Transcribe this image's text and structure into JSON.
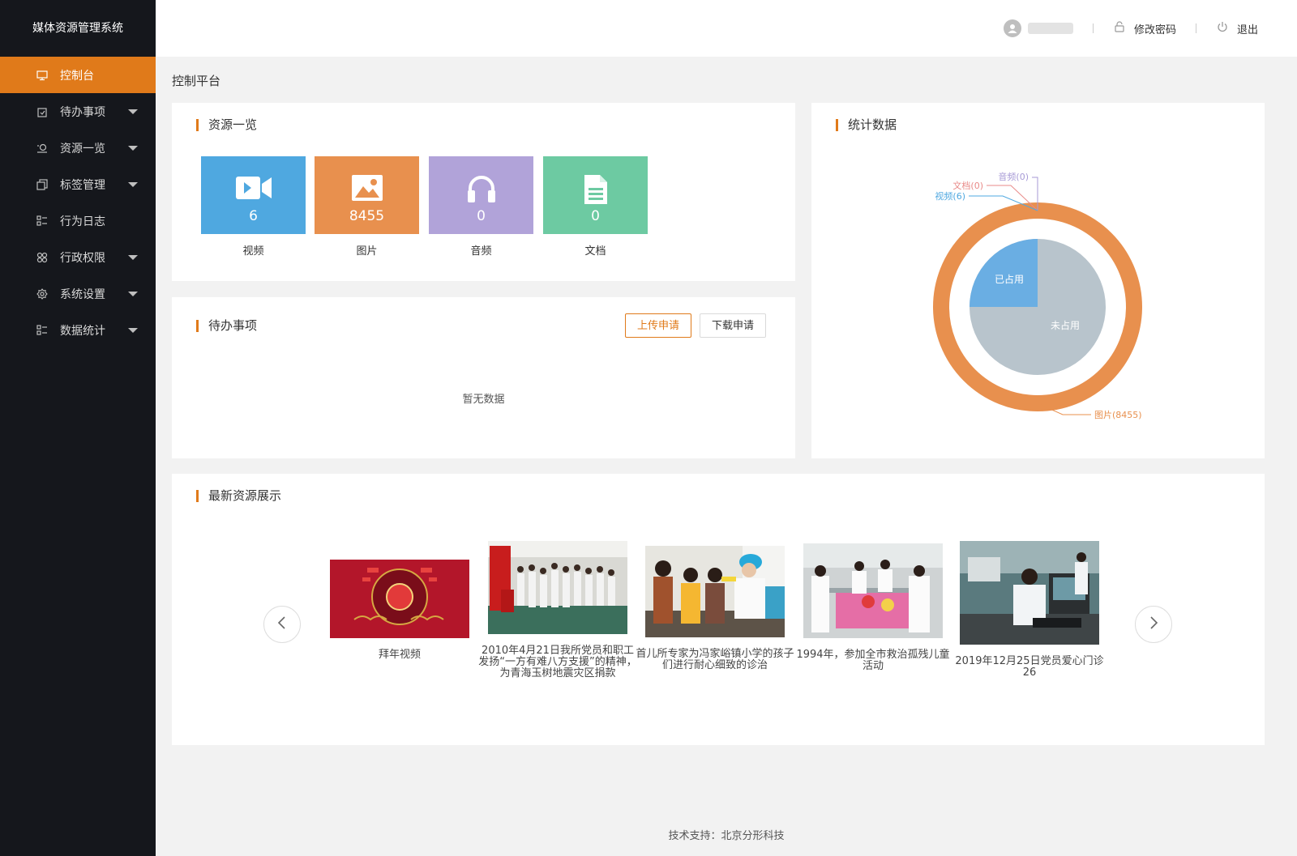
{
  "app": {
    "title": "媒体资源管理系统"
  },
  "sidebar": {
    "items": [
      {
        "label": "控制台",
        "icon": "monitor-icon",
        "active": true,
        "caret": false
      },
      {
        "label": "待办事项",
        "icon": "todo-icon",
        "caret": true
      },
      {
        "label": "资源一览",
        "icon": "resource-search-icon",
        "caret": true
      },
      {
        "label": "标签管理",
        "icon": "tag-copy-icon",
        "caret": true
      },
      {
        "label": "行为日志",
        "icon": "log-list-icon",
        "caret": false
      },
      {
        "label": "行政权限",
        "icon": "permission-grid-icon",
        "caret": true
      },
      {
        "label": "系统设置",
        "icon": "gear-icon",
        "caret": true
      },
      {
        "label": "数据统计",
        "icon": "stats-list-icon",
        "caret": true
      }
    ]
  },
  "header": {
    "change_password": "修改密码",
    "logout": "退出"
  },
  "page": {
    "title": "控制平台"
  },
  "resources": {
    "title": "资源一览",
    "tiles": [
      {
        "label": "视频",
        "count": "6",
        "color": "#4fa8e0",
        "icon": "video-camera-icon"
      },
      {
        "label": "图片",
        "count": "8455",
        "color": "#e8904e",
        "icon": "image-icon"
      },
      {
        "label": "音频",
        "count": "0",
        "color": "#b1a3d9",
        "icon": "headphones-icon"
      },
      {
        "label": "文档",
        "count": "0",
        "color": "#6dcaa2",
        "icon": "document-icon"
      }
    ]
  },
  "todo": {
    "title": "待办事项",
    "upload_btn": "上传申请",
    "download_btn": "下载申请",
    "empty_text": "暂无数据"
  },
  "stats": {
    "title": "统计数据",
    "outer_labels": {
      "audio": "音频(0)",
      "document": "文档(0)",
      "video": "视频(6)",
      "image": "图片(8455)"
    },
    "inner_labels": {
      "used": "已占用",
      "unused": "未占用"
    },
    "colors": {
      "image": "#e8904e",
      "video": "#4fa8e0",
      "document": "#e98a88",
      "audio": "#a79ad6",
      "used": "#6aaee3",
      "unused": "#b8c4cc"
    }
  },
  "chart_data": {
    "type": "pie",
    "outer_ring": [
      {
        "name": "图片",
        "value": 8455
      },
      {
        "name": "视频",
        "value": 6
      },
      {
        "name": "文档",
        "value": 0
      },
      {
        "name": "音频",
        "value": 0
      }
    ],
    "inner_pie": [
      {
        "name": "已占用",
        "value": 25
      },
      {
        "name": "未占用",
        "value": 75
      }
    ]
  },
  "latest": {
    "title": "最新资源展示",
    "items": [
      {
        "caption": "拜年视频"
      },
      {
        "caption": "2010年4月21日我所党员和职工发扬“一方有难八方支援”的精神，为青海玉树地震灾区捐款"
      },
      {
        "caption": "首儿所专家为冯家峪镇小学的孩子们进行耐心细致的诊治"
      },
      {
        "caption": "1994年，参加全市救治孤残儿童活动"
      },
      {
        "caption": "2019年12月25日党员爱心门诊26"
      }
    ]
  },
  "footer": {
    "text": "技术支持：北京分形科技"
  }
}
